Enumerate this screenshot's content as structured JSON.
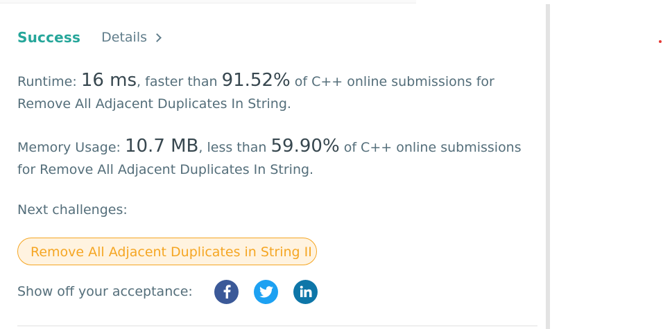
{
  "result": {
    "status": "Success",
    "details_label": "Details"
  },
  "runtime": {
    "label": "Runtime:",
    "value": "16 ms",
    "faster_than_text": ", faster than",
    "percent": "91.52%",
    "suffix": "of C++ online submissions for Remove All Adjacent Duplicates In String."
  },
  "memory": {
    "label": "Memory Usage:",
    "value": "10.7 MB",
    "less_than_text": ", less than",
    "percent": "59.90%",
    "suffix": "of C++ online submissions for Remove All Adjacent Duplicates In String."
  },
  "next": {
    "label": "Next challenges:",
    "challenges": [
      "Remove All Adjacent Duplicates in String II"
    ]
  },
  "share": {
    "label": "Show off your acceptance:",
    "icons": [
      "facebook-icon",
      "twitter-icon",
      "linkedin-icon"
    ]
  },
  "colors": {
    "success": "#26a69a",
    "challenge_accent": "#f5a623",
    "facebook": "#3b5998",
    "twitter": "#1da1f2",
    "linkedin": "#0e76a8"
  }
}
